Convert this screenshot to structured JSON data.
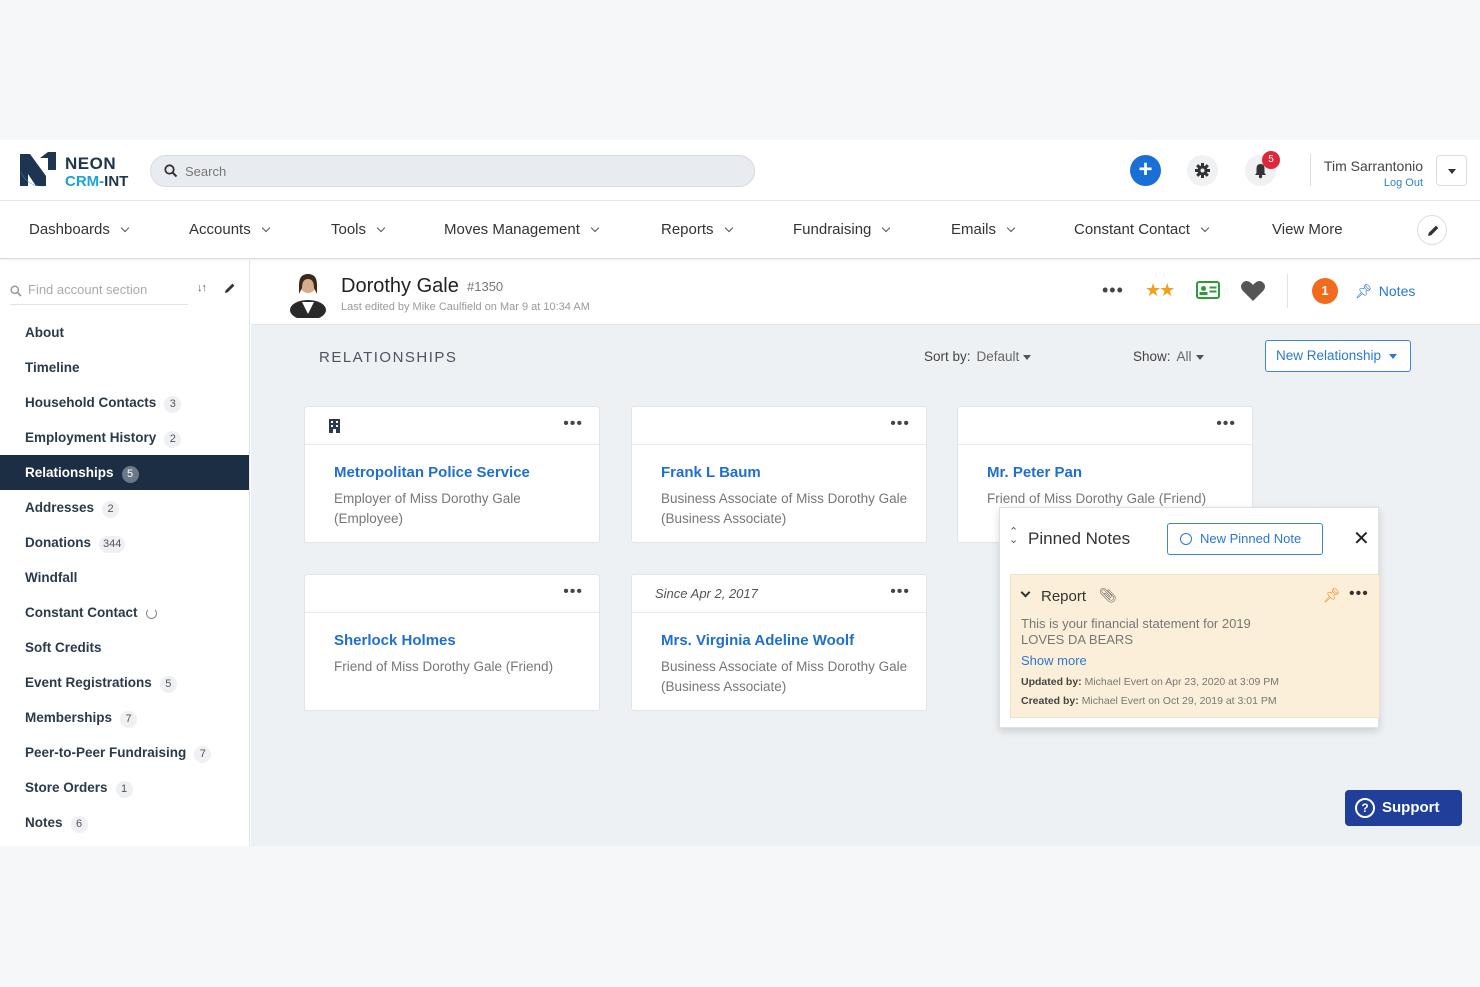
{
  "brand": {
    "line1": "NEON",
    "line2a": "CRM-",
    "line2b": "INT"
  },
  "search": {
    "placeholder": "Search"
  },
  "user": {
    "name": "Tim Sarrantonio",
    "logout": "Log Out",
    "notifications": "5"
  },
  "nav": {
    "items": [
      {
        "label": "Dashboards",
        "dropdown": true
      },
      {
        "label": "Accounts",
        "dropdown": true
      },
      {
        "label": "Tools",
        "dropdown": true
      },
      {
        "label": "Moves Management",
        "dropdown": true
      },
      {
        "label": "Reports",
        "dropdown": true
      },
      {
        "label": "Fundraising",
        "dropdown": true
      },
      {
        "label": "Emails",
        "dropdown": true
      },
      {
        "label": "Constant Contact",
        "dropdown": true
      },
      {
        "label": "View More",
        "dropdown": false
      }
    ]
  },
  "sidebar": {
    "find_placeholder": "Find account section",
    "items": [
      {
        "label": "About",
        "count": ""
      },
      {
        "label": "Timeline",
        "count": ""
      },
      {
        "label": "Household Contacts",
        "count": "3"
      },
      {
        "label": "Employment History",
        "count": "2"
      },
      {
        "label": "Relationships",
        "count": "5",
        "active": true
      },
      {
        "label": "Addresses",
        "count": "2"
      },
      {
        "label": "Donations",
        "count": "344"
      },
      {
        "label": "Windfall",
        "count": ""
      },
      {
        "label": "Constant Contact",
        "count": "",
        "loading": true
      },
      {
        "label": "Soft Credits",
        "count": ""
      },
      {
        "label": "Event Registrations",
        "count": "5"
      },
      {
        "label": "Memberships",
        "count": "7"
      },
      {
        "label": "Peer-to-Peer Fundraising",
        "count": "7"
      },
      {
        "label": "Store Orders",
        "count": "1"
      },
      {
        "label": "Notes",
        "count": "6"
      }
    ]
  },
  "account": {
    "name": "Dorothy Gale",
    "id": "#1350",
    "edited": "Last edited by Mike Caulfield on Mar 9 at 10:34 AM",
    "stars": "★★",
    "alert_count": "1",
    "notes_label": "Notes"
  },
  "relationships": {
    "title": "RELATIONSHIPS",
    "sort_label": "Sort by:",
    "sort_value": "Default",
    "show_label": "Show:",
    "show_value": "All",
    "new_button": "New Relationship",
    "cards": [
      {
        "since": "",
        "name": "Metropolitan Police Service",
        "desc": "Employer of Miss Dorothy Gale (Employee)",
        "org": true
      },
      {
        "since": "",
        "name": "Frank L Baum",
        "desc": "Business Associate of Miss Dorothy Gale (Business Associate)"
      },
      {
        "since": "",
        "name": "Mr. Peter Pan",
        "desc": "Friend of Miss Dorothy Gale (Friend)"
      },
      {
        "since": "",
        "name": "Sherlock Holmes",
        "desc": "Friend of Miss Dorothy Gale (Friend)"
      },
      {
        "since": "Since Apr 2, 2017",
        "name": "Mrs. Virginia Adeline Woolf",
        "desc": "Business Associate of Miss Dorothy Gale (Business Associate)"
      }
    ]
  },
  "pinned_notes": {
    "title": "Pinned Notes",
    "new_button": "New Pinned Note",
    "note": {
      "title": "Report",
      "line1": "This is your financial statement for 2019",
      "line2": "LOVES DA BEARS",
      "show_more": "Show more",
      "updated_label": "Updated by:",
      "updated_text": "Michael Evert on Apr 23, 2020 at 3:09 PM",
      "created_label": "Created by:",
      "created_text": "Michael Evert on Oct 29, 2019 at 3:01 PM"
    }
  },
  "support": {
    "label": "Support"
  },
  "colors": {
    "accent": "#1a6fd6",
    "link": "#1f6fcf",
    "sidebar_active": "#1c2e43",
    "alert": "#f26b1d",
    "note_bg": "#fcefd9",
    "support": "#1f3f9a"
  }
}
